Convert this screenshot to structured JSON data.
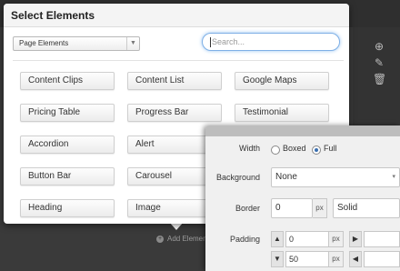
{
  "dialog": {
    "title": "Select Elements",
    "filter": {
      "selected": "Page Elements"
    },
    "search": {
      "placeholder": "Search..."
    },
    "elements": [
      "Content Clips",
      "Content List",
      "Google Maps",
      "Pricing Table",
      "Progress Bar",
      "Testimonial",
      "Accordion",
      "Alert",
      "Button Bar",
      "Carousel",
      "Heading",
      "Image"
    ]
  },
  "background": {
    "add_element_label": "Add Element",
    "icons": [
      "plus-circle-icon",
      "edit-icon",
      "trash-icon"
    ]
  },
  "panel": {
    "width_label": "Width",
    "width_options": [
      "Boxed",
      "Full"
    ],
    "width_selected": "Full",
    "background_label": "Background",
    "background_value": "None",
    "border_label": "Border",
    "border_width": "0",
    "border_unit": "px",
    "border_style": "Solid",
    "padding_label": "Padding",
    "padding_top": "0",
    "padding_top_unit": "px",
    "padding_bottom": "50",
    "padding_bottom_unit": "px"
  }
}
